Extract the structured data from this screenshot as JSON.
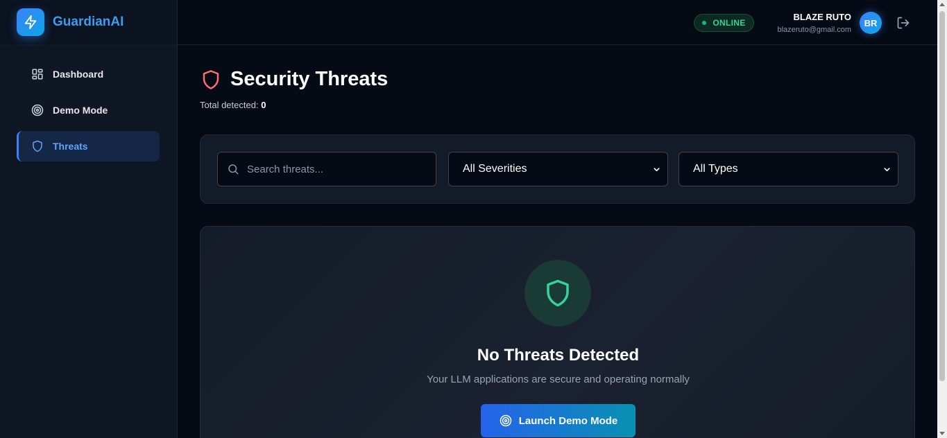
{
  "app": {
    "name": "GuardianAI"
  },
  "sidebar": {
    "items": [
      {
        "label": "Dashboard",
        "icon": "dashboard-grid-icon",
        "active": false
      },
      {
        "label": "Demo Mode",
        "icon": "target-icon",
        "active": false
      },
      {
        "label": "Threats",
        "icon": "shield-icon",
        "active": true
      }
    ]
  },
  "header": {
    "status": "ONLINE",
    "user_name": "BLAZE RUTO",
    "user_email": "blazeruto@gmail.com",
    "avatar_initials": "BR"
  },
  "page": {
    "title": "Security Threats",
    "total_label": "Total detected:",
    "total_value": "0"
  },
  "filters": {
    "search_placeholder": "Search threats...",
    "severity_selected": "All Severities",
    "type_selected": "All Types"
  },
  "empty_state": {
    "title": "No Threats Detected",
    "subtitle": "Your LLM applications are secure and operating normally",
    "button_label": "Launch Demo Mode"
  },
  "colors": {
    "accent": "#3b82f6",
    "success": "#34d399",
    "danger": "#f87171",
    "background": "#050a14"
  }
}
